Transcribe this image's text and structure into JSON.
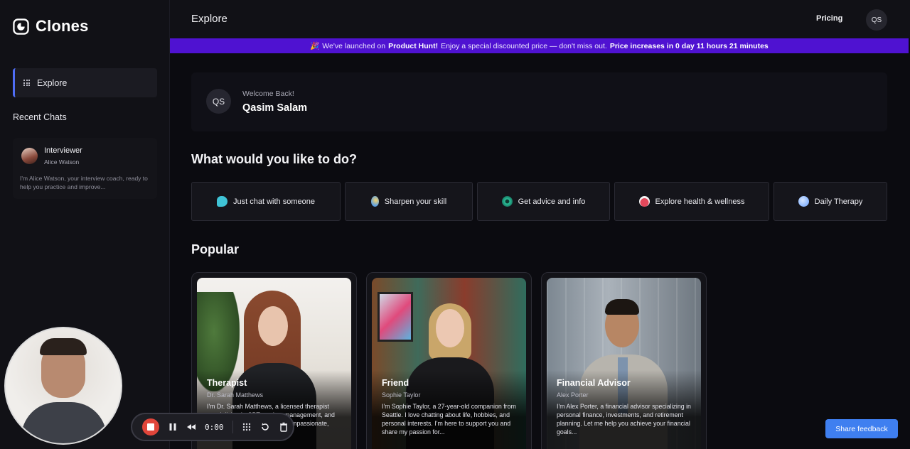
{
  "app": {
    "name": "Clones"
  },
  "sidebar": {
    "explore_label": "Explore",
    "recent_title": "Recent Chats",
    "recent_chats": [
      {
        "name": "Interviewer",
        "subtitle": "Alice Watson",
        "preview": "I'm Alice Watson, your interview coach, ready to help you practice and improve..."
      }
    ]
  },
  "header": {
    "title": "Explore",
    "pricing": "Pricing",
    "user_initials": "QS"
  },
  "banner": {
    "emoji": "🎉",
    "part1": "We've launched on",
    "product_hunt": "Product Hunt!",
    "part2": "Enjoy a special discounted price — don't miss out.",
    "countdown": "Price increases in 0 day 11 hours 21 minutes"
  },
  "welcome": {
    "initials": "QS",
    "label": "Welcome Back!",
    "name": "Qasim Salam"
  },
  "actions_title": "What would you like to do?",
  "actions": [
    {
      "label": "Just chat with someone",
      "icon": "chat-bubbles-icon",
      "color": "#3fc3d6"
    },
    {
      "label": "Sharpen your skill",
      "icon": "lightbulb-icon",
      "color": "#f2b84a"
    },
    {
      "label": "Get advice and info",
      "icon": "eye-icon",
      "color": "#2bc19a"
    },
    {
      "label": "Explore health & wellness",
      "icon": "heart-icon",
      "color": "#e2485b"
    },
    {
      "label": "Daily Therapy",
      "icon": "brain-icon",
      "color": "#8db8ff"
    }
  ],
  "popular_title": "Popular",
  "personas": [
    {
      "role": "Therapist",
      "name": "Dr. Sarah Matthews",
      "description": "I'm Dr. Sarah Matthews, a licensed therapist specializing in CBT, anxiety management, and emotional well-being. I offer compassionate, personalised support t..."
    },
    {
      "role": "Friend",
      "name": "Sophie Taylor",
      "description": "I'm Sophie Taylor, a 27-year-old companion from Seattle. I love chatting about life, hobbies, and personal interests. I'm here to support you and share my passion for..."
    },
    {
      "role": "Financial Advisor",
      "name": "Alex Porter",
      "description": "I'm Alex Porter, a financial advisor specializing in personal finance, investments, and retirement planning. Let me help you achieve your financial goals..."
    }
  ],
  "recorder": {
    "time": "0:00"
  },
  "feedback": "Share feedback"
}
